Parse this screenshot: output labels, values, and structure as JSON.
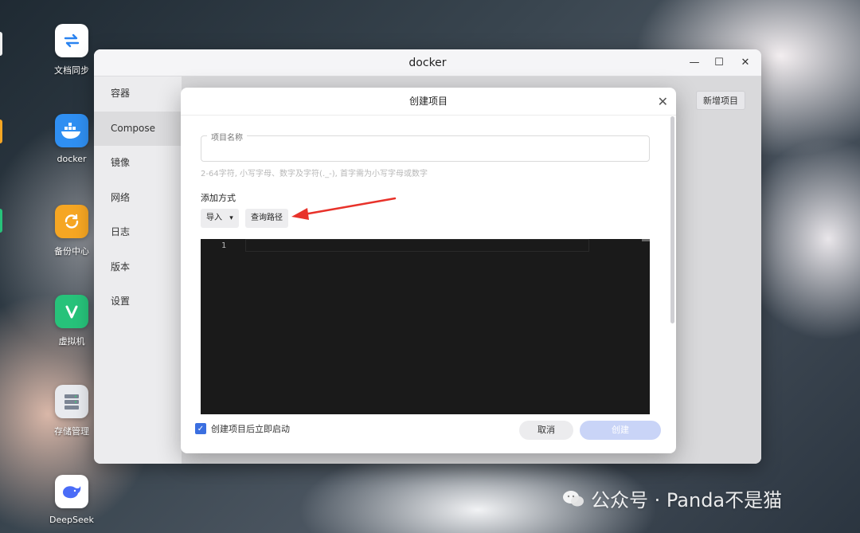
{
  "desktop": {
    "icons": [
      {
        "label": "文档同步",
        "color": "#ffffff",
        "icon": "sync-icon"
      },
      {
        "label": "docker",
        "color": "#2f8ff2",
        "icon": "docker-icon"
      },
      {
        "label": "备份中心",
        "color": "#f6a623",
        "icon": "backup-icon"
      },
      {
        "label": "虚拟机",
        "color": "#27c27a",
        "icon": "vm-icon"
      },
      {
        "label": "存储管理",
        "color": "#e8eaee",
        "icon": "storage-icon"
      },
      {
        "label": "DeepSeek",
        "color": "#ffffff",
        "icon": "deepseek-whale-icon"
      }
    ]
  },
  "window": {
    "title": "docker",
    "controls": {
      "minimize": "—",
      "maximize": "☐",
      "close": "✕"
    },
    "sidebar": {
      "items": [
        {
          "label": "容器"
        },
        {
          "label": "Compose",
          "active": true
        },
        {
          "label": "镜像"
        },
        {
          "label": "网络"
        },
        {
          "label": "日志"
        },
        {
          "label": "版本"
        },
        {
          "label": "设置"
        }
      ]
    },
    "new_project_label": "新增项目"
  },
  "modal": {
    "title": "创建项目",
    "close": "✕",
    "project_name_label": "项目名称",
    "project_name_value": "",
    "project_name_hint": "2-64字符, 小写字母、数字及字符(._-), 首字需为小写字母或数字",
    "add_method_label": "添加方式",
    "import_label": "导入",
    "import_caret": "▾",
    "query_path_label": "查询路径",
    "editor": {
      "line_numbers": [
        "1"
      ]
    },
    "auto_start_label": "创建项目后立即启动",
    "auto_start_checked": true,
    "check_mark": "✓",
    "cancel_label": "取消",
    "create_label": "创建"
  },
  "watermark": {
    "text": "公众号 · Panda不是猫"
  },
  "colors": {
    "annotation_arrow": "#e8322a",
    "primary": "#3b6fe0",
    "primary_disabled": "#c9d4f7"
  }
}
